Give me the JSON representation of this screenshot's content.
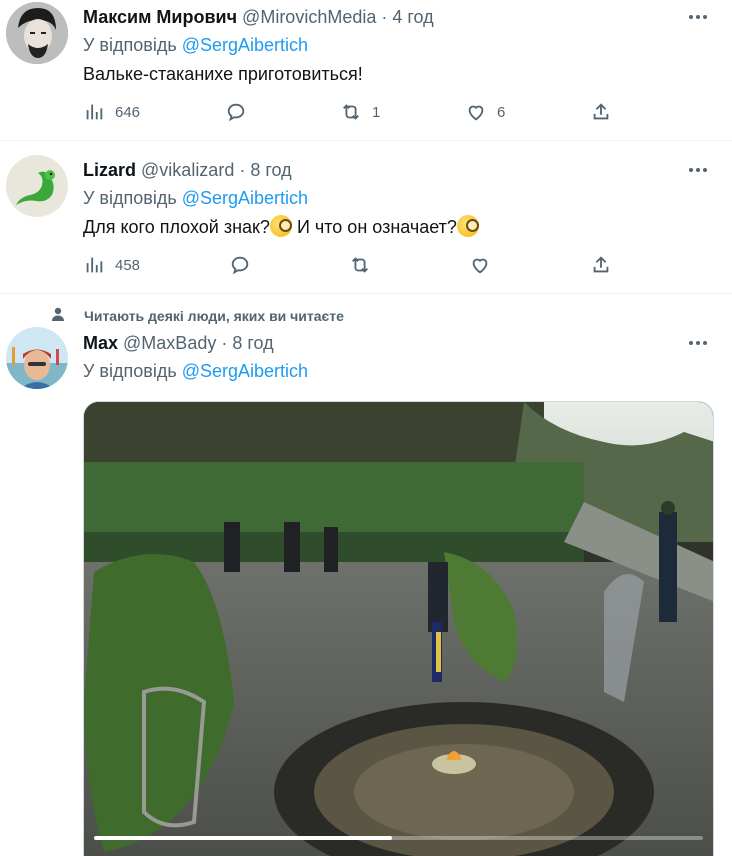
{
  "tweets": [
    {
      "name": "Максим Мирович",
      "handle": "@MirovichMedia",
      "time": "· 4 год",
      "reply_prefix": "У відповідь",
      "reply_to": "@SergAibertich",
      "text": "Вальке-стаканихе приготовиться!",
      "views": "646",
      "retweets": "1",
      "likes": "6"
    },
    {
      "name": "Lizard",
      "handle": "@vikalizard",
      "time": "· 8 год",
      "reply_prefix": "У відповідь",
      "reply_to": "@SergAibertich",
      "text_part1": "Для кого плохой знак?",
      "text_part2": " И что он означает?",
      "views": "458",
      "retweets": "",
      "likes": ""
    },
    {
      "social_context": "Читають деякі люди, яких ви читаєте",
      "name": "Max",
      "handle": "@MaxBady",
      "time": "· 8 год",
      "reply_prefix": "У відповідь",
      "reply_to": "@SergAibertich",
      "video_progress": 0.49
    }
  ],
  "icons": {
    "views": "bar-chart-icon",
    "reply": "comment-bubble-icon",
    "retweet": "retweet-arrows-icon",
    "like": "heart-icon",
    "share": "share-upload-icon",
    "more": "more-dots-icon",
    "social": "person-icon",
    "emoji": "monocle-face-emoji"
  },
  "colors": {
    "accent": "#1d9bf0",
    "secondary_text": "#536471",
    "primary_text": "#0f1419"
  }
}
